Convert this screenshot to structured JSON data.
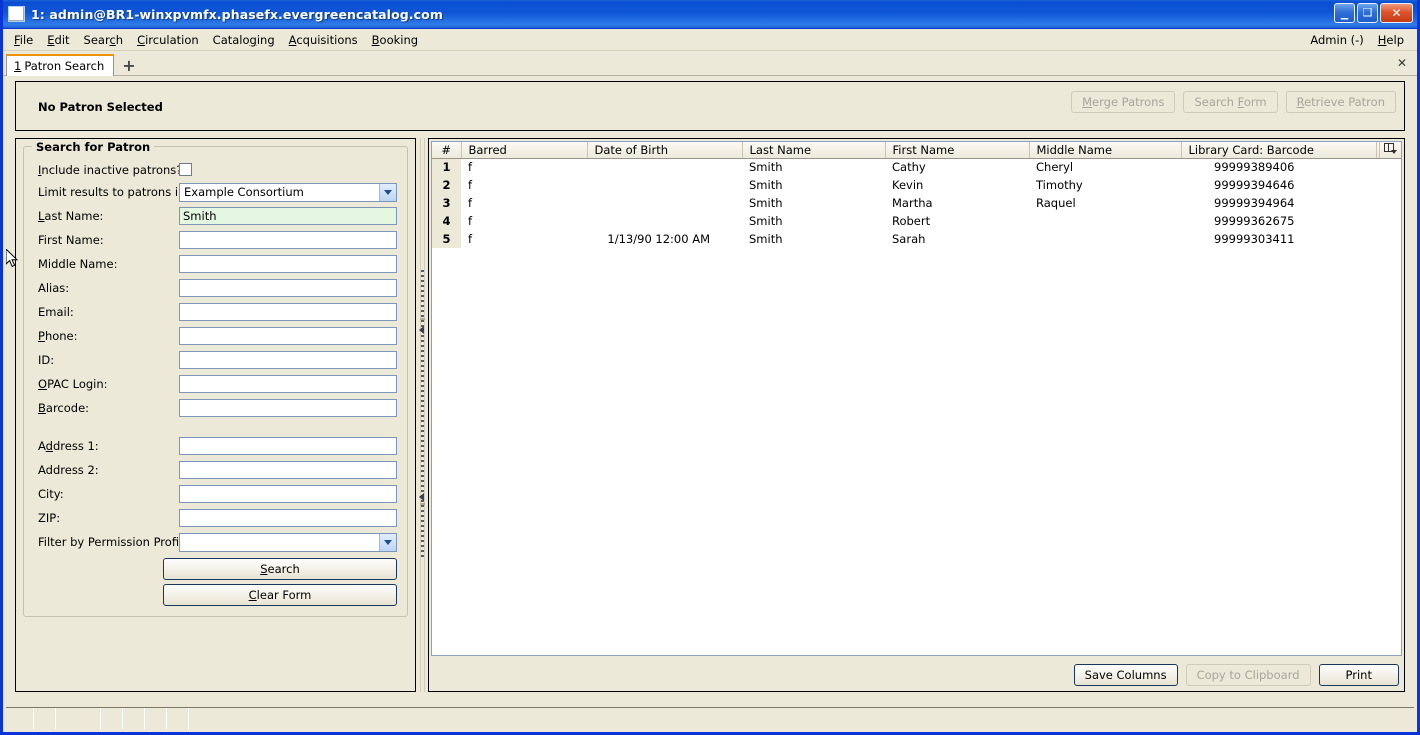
{
  "window": {
    "title": "1: admin@BR1-winxpvmfx.phasefx.evergreencatalog.com",
    "icon": "window-icon",
    "minimize_label": "_",
    "maximize_label": "❐",
    "close_label": "✕"
  },
  "menubar": {
    "items": [
      {
        "label": "File",
        "accesskey": "F"
      },
      {
        "label": "Edit",
        "accesskey": "E"
      },
      {
        "label": "Search",
        "accesskey": "c"
      },
      {
        "label": "Circulation",
        "accesskey": "C"
      },
      {
        "label": "Cataloging",
        "accesskey": "g"
      },
      {
        "label": "Acquisitions",
        "accesskey": "A"
      },
      {
        "label": "Booking",
        "accesskey": "B"
      }
    ],
    "right": [
      {
        "label": "Admin (-)",
        "accesskey": ""
      },
      {
        "label": "Help",
        "accesskey": "H"
      }
    ]
  },
  "tabbar": {
    "tabs": [
      {
        "number": "1",
        "label": "Patron Search"
      }
    ],
    "new_tab_label": "+",
    "close_label": "✕"
  },
  "patron_banner": {
    "status": "No Patron Selected",
    "buttons": [
      {
        "label": "Merge Patrons",
        "accesskey": "M",
        "disabled": true
      },
      {
        "label": "Search Form",
        "accesskey": "F",
        "disabled": true
      },
      {
        "label": "Retrieve Patron",
        "accesskey": "R",
        "disabled": true
      }
    ]
  },
  "search_form": {
    "legend": "Search for Patron",
    "include_inactive": {
      "label": "Include inactive patrons?",
      "accesskey": "I",
      "checked": false
    },
    "limit_results": {
      "label": "Limit results to patrons in",
      "value": "Example Consortium",
      "options": [
        "Example Consortium"
      ]
    },
    "fields": [
      {
        "name": "last-name",
        "label": "Last Name:",
        "accesskey": "L",
        "value": "Smith",
        "active": true
      },
      {
        "name": "first-name",
        "label": "First Name:",
        "accesskey": "",
        "value": "",
        "active": false
      },
      {
        "name": "middle-name",
        "label": "Middle Name:",
        "accesskey": "",
        "value": "",
        "active": false
      },
      {
        "name": "alias",
        "label": "Alias:",
        "accesskey": "",
        "value": "",
        "active": false
      },
      {
        "name": "email",
        "label": "Email:",
        "accesskey": "",
        "value": "",
        "active": false
      },
      {
        "name": "phone",
        "label": "Phone:",
        "accesskey": "P",
        "value": "",
        "active": false
      },
      {
        "name": "id",
        "label": "ID:",
        "accesskey": "",
        "value": "",
        "active": false
      },
      {
        "name": "opac-login",
        "label": "OPAC Login:",
        "accesskey": "O",
        "value": "",
        "active": false
      },
      {
        "name": "barcode",
        "label": "Barcode:",
        "accesskey": "B",
        "value": "",
        "active": false
      }
    ],
    "address_fields": [
      {
        "name": "address-1",
        "label": "Address 1:",
        "accesskey": "d",
        "value": ""
      },
      {
        "name": "address-2",
        "label": "Address 2:",
        "accesskey": "",
        "value": ""
      },
      {
        "name": "city",
        "label": "City:",
        "accesskey": "",
        "value": ""
      },
      {
        "name": "zip",
        "label": "ZIP:",
        "accesskey": "",
        "value": ""
      }
    ],
    "permission_profile": {
      "label": "Filter by Permission Profile:",
      "value": "",
      "options": []
    },
    "search_button": {
      "label": "Search",
      "accesskey": "S"
    },
    "clear_button": {
      "label": "Clear Form",
      "accesskey": "C"
    }
  },
  "results": {
    "columns": [
      {
        "key": "num",
        "label": "#"
      },
      {
        "key": "barred",
        "label": "Barred"
      },
      {
        "key": "dob",
        "label": "Date of Birth"
      },
      {
        "key": "last",
        "label": "Last Name"
      },
      {
        "key": "first",
        "label": "First Name"
      },
      {
        "key": "middle",
        "label": "Middle Name"
      },
      {
        "key": "card",
        "label": "Library Card: Barcode"
      }
    ],
    "column_picker_icon": "column-picker-icon",
    "rows": [
      {
        "num": "1",
        "barred": "f",
        "dob": "",
        "last": "Smith",
        "first": "Cathy",
        "middle": "Cheryl",
        "card": "99999389406"
      },
      {
        "num": "2",
        "barred": "f",
        "dob": "",
        "last": "Smith",
        "first": "Kevin",
        "middle": "Timothy",
        "card": "99999394646"
      },
      {
        "num": "3",
        "barred": "f",
        "dob": "",
        "last": "Smith",
        "first": "Martha",
        "middle": "Raquel",
        "card": "99999394964"
      },
      {
        "num": "4",
        "barred": "f",
        "dob": "",
        "last": "Smith",
        "first": "Robert",
        "middle": "",
        "card": "99999362675"
      },
      {
        "num": "5",
        "barred": "f",
        "dob": "1/13/90 12:00 AM",
        "last": "Smith",
        "first": "Sarah",
        "middle": "",
        "card": "99999303411"
      }
    ],
    "buttons": [
      {
        "label": "Save Columns",
        "disabled": false
      },
      {
        "label": "Copy to Clipboard",
        "disabled": true
      },
      {
        "label": "Print",
        "disabled": false
      }
    ]
  },
  "statusbar": {
    "segments": [
      "",
      "",
      "",
      "",
      "",
      "",
      "",
      ""
    ]
  }
}
